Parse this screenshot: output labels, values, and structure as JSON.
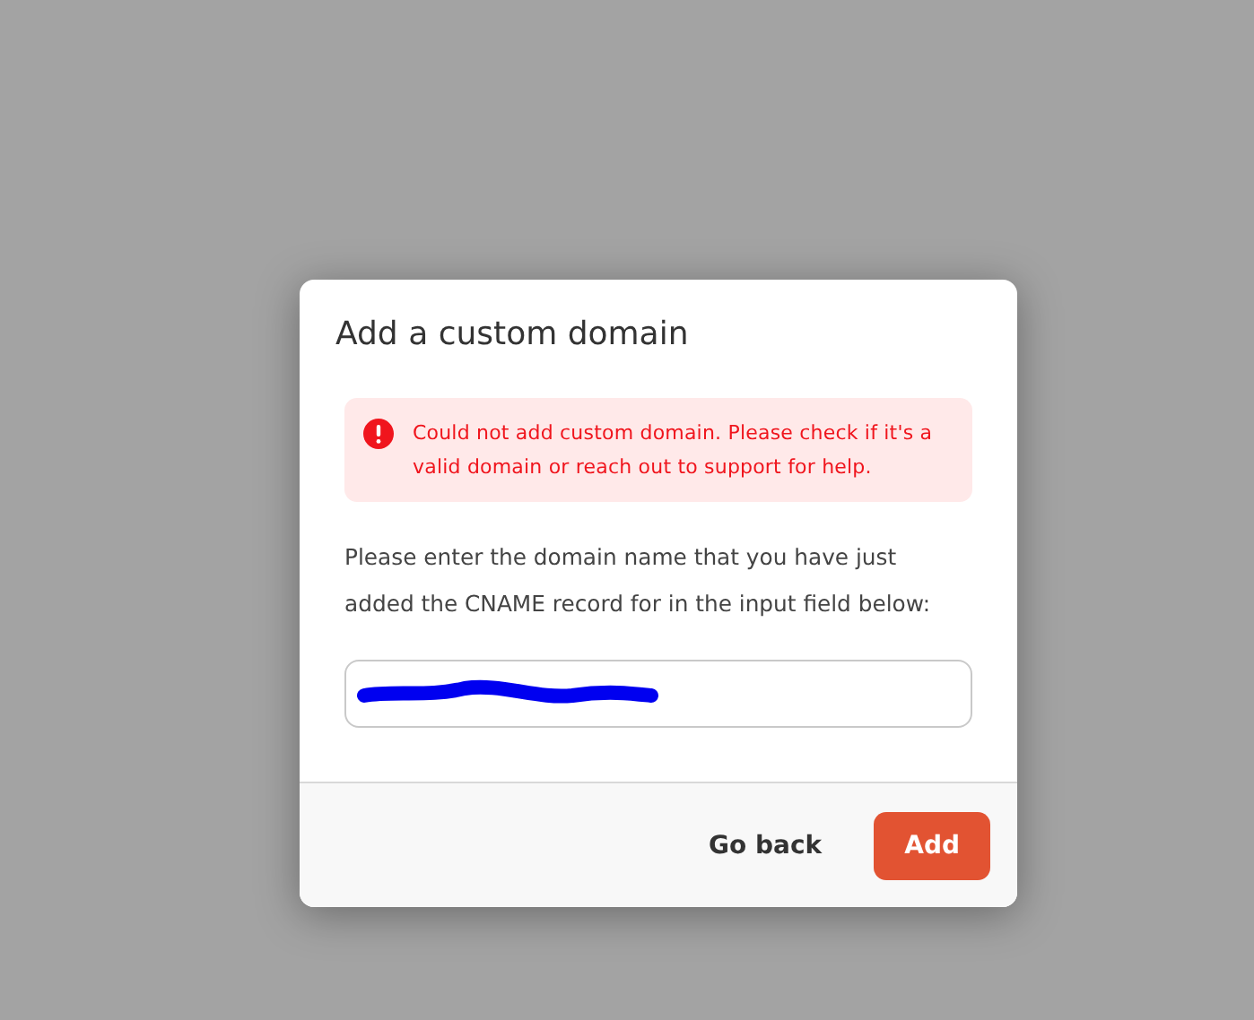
{
  "dialog": {
    "title": "Add a custom domain",
    "alert": {
      "kind": "error",
      "message": "Could not add custom domain. Please check if it's a valid domain or reach out to support for help."
    },
    "instructions": "Please enter the domain name that you have just added the CNAME record for in the input field below:",
    "domain_field": {
      "redacted": true
    },
    "buttons": [
      {
        "label": "Go back",
        "kind": "secondary"
      },
      {
        "label": "Add",
        "kind": "primary"
      }
    ]
  }
}
